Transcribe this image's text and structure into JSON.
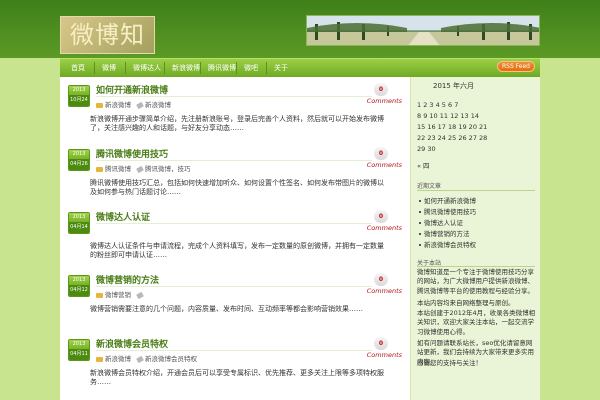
{
  "site": {
    "logo_text": "微博知道",
    "banner_alt": "tree-lined avenue photo"
  },
  "nav": {
    "items": [
      "首頁",
      "微博",
      "微博达人",
      "新浪微博",
      "腾讯微博",
      "微吧",
      "关于"
    ],
    "rss_label": "RSS Feed"
  },
  "posts": [
    {
      "year": "2013",
      "md": "10月24",
      "title": "如何开通新浪微博",
      "category": "新浪微博",
      "tags": [
        "新浪微博"
      ],
      "comments": "0",
      "comments_label": "Comments",
      "excerpt": "新浪微博开通步骤简单介绍，先注册新浪账号，登录后完善个人资料，然后就可以开始发布微博了，关注感兴趣的人和话题，与好友分享动态……"
    },
    {
      "year": "2013",
      "md": "04月26",
      "title": "腾讯微博使用技巧",
      "category": "腾讯微博",
      "tags": [
        "腾讯微博，技巧"
      ],
      "comments": "0",
      "comments_label": "Comments",
      "excerpt": "腾讯微博使用技巧汇总，包括如何快速增加听众、如何设置个性签名、如何发布带图片的微博以及如何参与热门话题讨论……"
    },
    {
      "year": "2013",
      "md": "04月14",
      "title": "微博达人认证",
      "category": "",
      "tags": [],
      "comments": "0",
      "comments_label": "Comments",
      "excerpt": "微博达人认证条件与申请流程，完成个人资料填写，发布一定数量的原创微博，并拥有一定数量的粉丝即可申请认证……"
    },
    {
      "year": "2013",
      "md": "04月12",
      "title": "微博营销的方法",
      "category": "微博营销",
      "tags": [
        ""
      ],
      "comments": "0",
      "comments_label": "Comments",
      "excerpt": "微博营销需要注意的几个问题，内容质量、发布时间、互动频率等都会影响营销效果……"
    },
    {
      "year": "2013",
      "md": "04月11",
      "title": "新浪微博会员特权",
      "category": "新浪微博",
      "tags": [
        "新浪微博会员特权"
      ],
      "comments": "0",
      "comments_label": "Comments",
      "excerpt": "新浪微博会员特权介绍，开通会员后可以享受专属标识、优先推荐、更多关注上限等多项特权服务……"
    }
  ],
  "sidebar": {
    "calendar": {
      "title": "2015 年六月",
      "rows": [
        "1 2 3 4 5 6 7",
        "8 9 10 11 12 13 14",
        "15 16 17 18 19 20 21",
        "22 23 24 25 26 27 28",
        "29 30",
        "« 四"
      ]
    },
    "recent": {
      "title": "近期文章",
      "items": [
        "如何开通新浪微博",
        "腾讯微博使用技巧",
        "微博达人认证",
        "微博营销的方法",
        "新浪微博会员特权"
      ]
    },
    "about": {
      "title": "关于本站",
      "paragraphs": [
        "微博知道是一个专注于微博使用技巧分享的网站，为广大微博用户提供新浪微博、腾讯微博等平台的使用教程与经验分享。",
        "本站内容均来自网络整理与原创。",
        "本站创建于2012年4月，收录各类微博相关知识，欢迎大家关注本站，一起交流学习微博使用心得。",
        "如有问题请联系站长，seo优化请留意网站更新，我们会持续为大家带来更多实用内容。",
        "感谢您的支持与关注！"
      ]
    }
  }
}
